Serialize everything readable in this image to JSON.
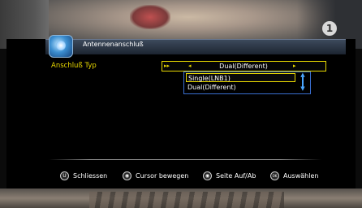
{
  "channel": {
    "logo_text": "1"
  },
  "menu": {
    "title": "Antennenanschluß",
    "icon": "satellite-dish-icon"
  },
  "setting": {
    "label": "Anschluß Typ",
    "fast_forward_icon": "▸▸",
    "arrow_left": "◂",
    "arrow_right": "▸",
    "value": "Dual(Different)"
  },
  "dropdown": {
    "options": [
      {
        "label": "Single(LNB1)",
        "selected": true
      },
      {
        "label": "Dual(Different)",
        "selected": false
      }
    ],
    "scroll_up": "▲",
    "scroll_down": "▼"
  },
  "footer": {
    "hints": [
      {
        "key": "U",
        "label": "Schliessen",
        "icon": "exit-key-icon"
      },
      {
        "key": "◉",
        "label": "Cursor bewegen",
        "icon": "cursor-key-icon"
      },
      {
        "key": "◉",
        "label": "Seite Auf/Ab",
        "icon": "page-key-icon"
      },
      {
        "key": "OK",
        "label": "Auswählen",
        "icon": "ok-key-icon"
      }
    ]
  },
  "colors": {
    "accent_yellow": "#e8d800",
    "dropdown_border": "#3a6fd0",
    "scroll_blue": "#4aa6ff"
  }
}
